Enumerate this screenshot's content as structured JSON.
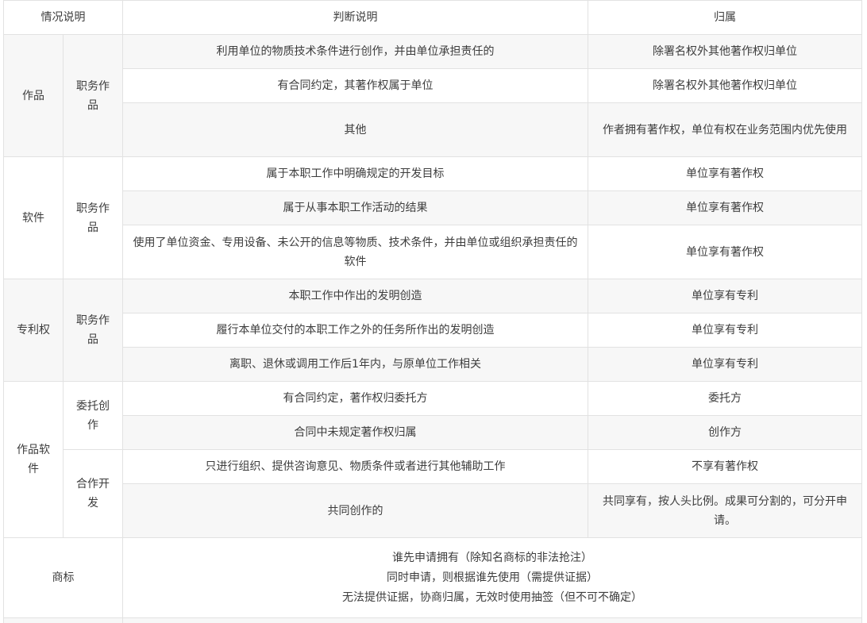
{
  "header": {
    "col1": "情况说明",
    "col2": "判断说明",
    "col3": "归属"
  },
  "groups": [
    {
      "category": "作品",
      "subcategory": "职务作品",
      "rows": [
        {
          "judgment": "利用单位的物质技术条件进行创作，并由单位承担责任的",
          "owner": "除署名权外其他著作权归单位"
        },
        {
          "judgment": "有合同约定，其著作权属于单位",
          "owner": "除署名权外其他著作权归单位"
        },
        {
          "judgment": "其他",
          "owner": "作者拥有著作权，单位有权在业务范围内优先使用"
        }
      ]
    },
    {
      "category": "软件",
      "subcategory": "职务作品",
      "rows": [
        {
          "judgment": "属于本职工作中明确规定的开发目标",
          "owner": "单位享有著作权"
        },
        {
          "judgment": "属于从事本职工作活动的结果",
          "owner": "单位享有著作权"
        },
        {
          "judgment": "使用了单位资金、专用设备、未公开的信息等物质、技术条件，并由单位或组织承担责任的软件",
          "owner": "单位享有著作权"
        }
      ]
    },
    {
      "category": "专利权",
      "subcategory": "职务作品",
      "rows": [
        {
          "judgment": "本职工作中作出的发明创造",
          "owner": "单位享有专利"
        },
        {
          "judgment": "履行本单位交付的本职工作之外的任务所作出的发明创造",
          "owner": "单位享有专利"
        },
        {
          "judgment": "离职、退休或调用工作后1年内，与原单位工作相关",
          "owner": "单位享有专利"
        }
      ]
    },
    {
      "category": "作品软件",
      "subgroups": [
        {
          "subcategory": "委托创作",
          "rows": [
            {
              "judgment": "有合同约定，著作权归委托方",
              "owner": "委托方"
            },
            {
              "judgment": "合同中未规定著作权归属",
              "owner": "创作方"
            }
          ]
        },
        {
          "subcategory": "合作开发",
          "rows": [
            {
              "judgment": "只进行组织、提供咨询意见、物质条件或者进行其他辅助工作",
              "owner": "不享有著作权"
            },
            {
              "judgment": "共同创作的",
              "owner": "共同享有，按人头比例。成果可分割的，可分开申请。"
            }
          ]
        }
      ]
    },
    {
      "category": "商标",
      "lines": [
        "谁先申请拥有（除知名商标的非法抢注）",
        "同时申请，则根据谁先使用（需提供证据）",
        "无法提供证据，协商归属，无效时使用抽签（但不可不确定）"
      ]
    }
  ]
}
